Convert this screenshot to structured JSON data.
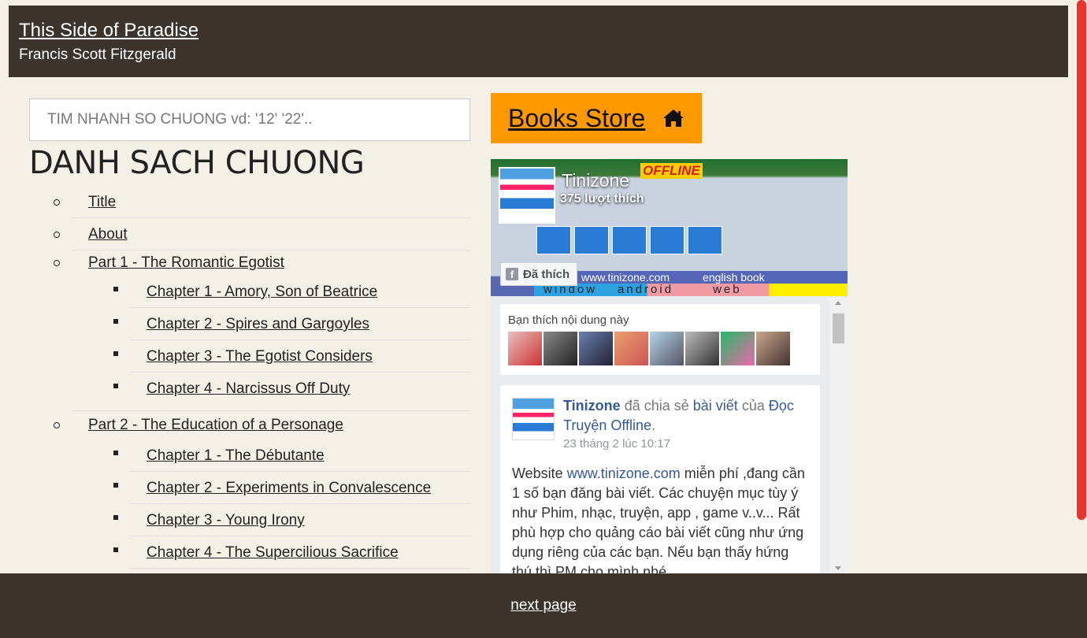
{
  "header": {
    "title": "This Side of Paradise",
    "author": "Francis Scott Fitzgerald"
  },
  "search": {
    "placeholder": "TIM NHANH SO CHUONG vd: '12' '22'.."
  },
  "toc": {
    "heading": "DANH SACH CHUONG",
    "items": [
      {
        "label": "Title"
      },
      {
        "label": "About"
      },
      {
        "label": "Part 1 - The Romantic Egotist"
      },
      {
        "label": "Chapter 1 - Amory, Son of Beatrice"
      },
      {
        "label": "Chapter 2 - Spires and Gargoyles"
      },
      {
        "label": "Chapter 3 - The Egotist Considers"
      },
      {
        "label": "Chapter 4 - Narcissus Off Duty"
      },
      {
        "label": "Part 2 - The Education of a Personage"
      },
      {
        "label": "Chapter 1 - The Débutante"
      },
      {
        "label": "Chapter 2 - Experiments in Convalescence"
      },
      {
        "label": "Chapter 3 - Young Irony"
      },
      {
        "label": "Chapter 4 - The Supercilious Sacrifice"
      }
    ]
  },
  "store": {
    "label": "Books Store",
    "icon": "home-icon"
  },
  "facebook": {
    "page_name": "Tinizone",
    "likes": "375 lượt thích",
    "liked_button": "Đã thích",
    "cover_offline": "OFFLINE",
    "cover_url": "www.tinizone.com",
    "cover_english": "english book",
    "cover_window": "window",
    "cover_android": "android",
    "cover_web": "web",
    "fans_caption": "Bạn thích nội dung này",
    "post": {
      "author": "Tinizone",
      "shared": "đã chia sẻ",
      "post_link": "bài viết",
      "of": "của",
      "source": "Đọc Truyện Offline",
      "time": "23 tháng 2 lúc 10:17",
      "body_prefix": "Website",
      "body_link": "www.tinizone.com",
      "body_text": "miễn phí ,đang cần 1 số bạn đăng bài viết. Các chuyện mục tùy ý như Phim, nhạc, truyện, app , game v..v... Rất phù hợp cho quảng cáo bài viết cũng như ứng dụng riêng của các bạn. Nếu bạn thấy hứng thú thì PM cho mình nhé"
    }
  },
  "footer": {
    "next": "next page"
  },
  "colors": {
    "header_bg": "#3b332c",
    "page_bg": "#f4f0e6",
    "store_bg": "#fe9a00",
    "scroll_thumb": "#e8332f",
    "fb_link": "#365899"
  }
}
